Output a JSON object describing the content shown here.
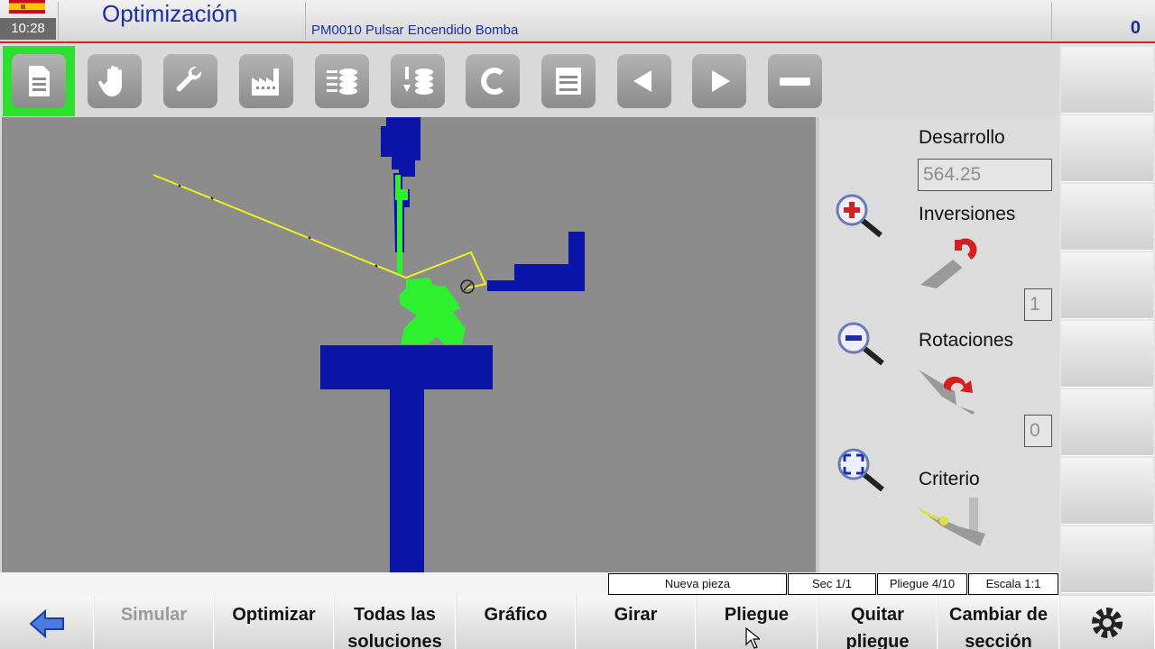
{
  "header": {
    "time": "10:28",
    "title": "Optimización",
    "message": "PM0010 Pulsar Encendido Bomba",
    "counter": "0"
  },
  "toolbar": {
    "active_index": 0,
    "icons": [
      "document-icon",
      "hand-icon",
      "wrench-icon",
      "factory-icon",
      "stack-list-icon",
      "tool-stack-icon",
      "c-letter-icon",
      "printer-icon",
      "arrow-left-icon",
      "arrow-right-icon",
      "minus-icon"
    ]
  },
  "panel": {
    "desarrollo_label": "Desarrollo",
    "desarrollo_value": "564.25",
    "inversiones_label": "Inversiones",
    "inversiones_value": "1",
    "rotaciones_label": "Rotaciones",
    "rotaciones_value": "0",
    "criterio_label": "Criterio"
  },
  "status": {
    "piece": "Nueva pieza",
    "sec": "Sec  1/1",
    "pliegue": "Pliegue 4/10",
    "escala": "Escala 1:1"
  },
  "bottom": {
    "back_icon": "back-arrow-icon",
    "simular": "Simular",
    "optimizar": "Optimizar",
    "todas_1": "Todas las",
    "todas_2": "soluciones",
    "grafico": "Gráfico",
    "girar": "Girar",
    "pliegue": "Pliegue",
    "quitar_1": "Quitar",
    "quitar_2": "pliegue",
    "cambiar_1": "Cambiar de",
    "cambiar_2": "sección",
    "menu_icon": "gear-icon"
  },
  "colors": {
    "accent_title": "#1a2ea8",
    "active_green": "#2ee02e",
    "tool_blue": "#0b14a8",
    "piece_yellow": "#f0f020",
    "part_green": "#2ef02e",
    "canvas_bg": "#8c8c8c"
  }
}
